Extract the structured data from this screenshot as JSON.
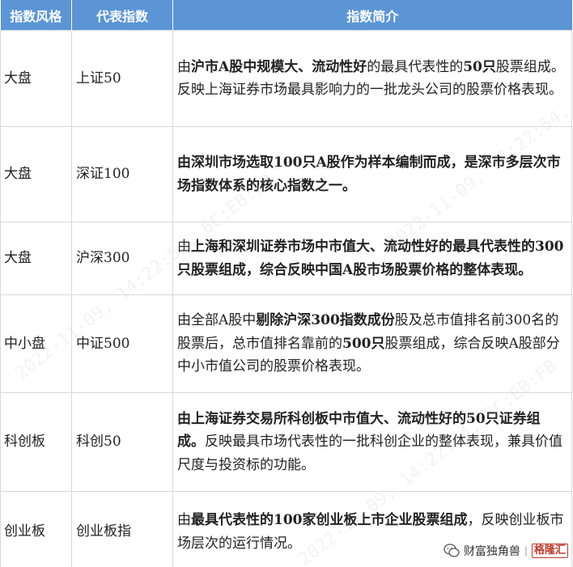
{
  "table": {
    "headers": [
      "指数风格",
      "代表指数",
      "指数简介"
    ],
    "rows": [
      {
        "style": "大盘",
        "index": "上证50",
        "desc": [
          {
            "t": "由",
            "b": false
          },
          {
            "t": "沪市A股中规模大、流动性好",
            "b": true
          },
          {
            "t": "的最具代表性的",
            "b": false
          },
          {
            "t": "50只",
            "b": true
          },
          {
            "t": "股票组成。反映上海证券市场最具影响力的一批龙头公司的股票价格表现。",
            "b": false
          }
        ]
      },
      {
        "style": "大盘",
        "index": "深证100",
        "desc": [
          {
            "t": "由深圳市场选取100只A股作为样本编制而成，是深市多层次市场指数体系的核心指数之一。",
            "b": true
          }
        ]
      },
      {
        "style": "大盘",
        "index": "沪深300",
        "desc": [
          {
            "t": "由",
            "b": false
          },
          {
            "t": "上海和深圳证券市场中市值大、流动性好的最具代表性的300只股票组成，综合反映中国A股市场股票价格的整体表现。",
            "b": true
          }
        ]
      },
      {
        "style": "中小盘",
        "index": "中证500",
        "desc": [
          {
            "t": "由全部A股中",
            "b": false
          },
          {
            "t": "剔除沪深300指数成份",
            "b": true
          },
          {
            "t": "股及总市值排名前300名的股票后，总市值排名靠前的",
            "b": false
          },
          {
            "t": "500只",
            "b": true
          },
          {
            "t": "股票组成，综合反映A股部分中小市值公司的股票价格表现。",
            "b": false
          }
        ]
      },
      {
        "style": "科创板",
        "index": "科创50",
        "desc": [
          {
            "t": "由上海证券交易所科创板中市值大、流动性好的50只证券组成。",
            "b": true
          },
          {
            "t": "反映最具市场代表性的一批科创企业的整体表现，兼具价值尺度与投资标的功能。",
            "b": false
          }
        ]
      },
      {
        "style": "创业板",
        "index": "创业板指",
        "desc": [
          {
            "t": "由",
            "b": false
          },
          {
            "t": "最具代表性的100家创业板上市企业股票组成",
            "b": true
          },
          {
            "t": "，反映创业板市场层次的运行情况。",
            "b": false
          }
        ]
      }
    ]
  },
  "watermark": {
    "text": "2022-11-09, 14:22:54, 6C:EB:FB"
  },
  "logo": {
    "brand": "财富独角兽",
    "separator": "|",
    "site": "格隆汇"
  },
  "colors": {
    "header_bg": "#5b95d6",
    "header_text": "#ffffff",
    "grid": "#d9d9d9"
  }
}
